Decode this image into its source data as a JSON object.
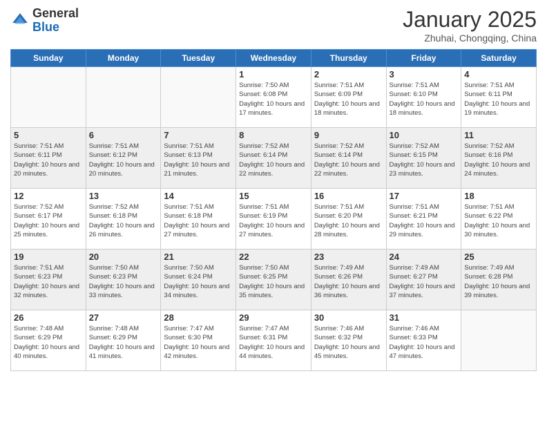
{
  "header": {
    "logo_general": "General",
    "logo_blue": "Blue",
    "month_title": "January 2025",
    "subtitle": "Zhuhai, Chongqing, China"
  },
  "days_of_week": [
    "Sunday",
    "Monday",
    "Tuesday",
    "Wednesday",
    "Thursday",
    "Friday",
    "Saturday"
  ],
  "weeks": [
    [
      {
        "day": null
      },
      {
        "day": null
      },
      {
        "day": null
      },
      {
        "day": "1",
        "sunrise": "7:50 AM",
        "sunset": "6:08 PM",
        "daylight": "10 hours and 17 minutes."
      },
      {
        "day": "2",
        "sunrise": "7:51 AM",
        "sunset": "6:09 PM",
        "daylight": "10 hours and 18 minutes."
      },
      {
        "day": "3",
        "sunrise": "7:51 AM",
        "sunset": "6:10 PM",
        "daylight": "10 hours and 18 minutes."
      },
      {
        "day": "4",
        "sunrise": "7:51 AM",
        "sunset": "6:11 PM",
        "daylight": "10 hours and 19 minutes."
      }
    ],
    [
      {
        "day": "5",
        "sunrise": "7:51 AM",
        "sunset": "6:11 PM",
        "daylight": "10 hours and 20 minutes."
      },
      {
        "day": "6",
        "sunrise": "7:51 AM",
        "sunset": "6:12 PM",
        "daylight": "10 hours and 20 minutes."
      },
      {
        "day": "7",
        "sunrise": "7:51 AM",
        "sunset": "6:13 PM",
        "daylight": "10 hours and 21 minutes."
      },
      {
        "day": "8",
        "sunrise": "7:52 AM",
        "sunset": "6:14 PM",
        "daylight": "10 hours and 22 minutes."
      },
      {
        "day": "9",
        "sunrise": "7:52 AM",
        "sunset": "6:14 PM",
        "daylight": "10 hours and 22 minutes."
      },
      {
        "day": "10",
        "sunrise": "7:52 AM",
        "sunset": "6:15 PM",
        "daylight": "10 hours and 23 minutes."
      },
      {
        "day": "11",
        "sunrise": "7:52 AM",
        "sunset": "6:16 PM",
        "daylight": "10 hours and 24 minutes."
      }
    ],
    [
      {
        "day": "12",
        "sunrise": "7:52 AM",
        "sunset": "6:17 PM",
        "daylight": "10 hours and 25 minutes."
      },
      {
        "day": "13",
        "sunrise": "7:52 AM",
        "sunset": "6:18 PM",
        "daylight": "10 hours and 26 minutes."
      },
      {
        "day": "14",
        "sunrise": "7:51 AM",
        "sunset": "6:18 PM",
        "daylight": "10 hours and 27 minutes."
      },
      {
        "day": "15",
        "sunrise": "7:51 AM",
        "sunset": "6:19 PM",
        "daylight": "10 hours and 27 minutes."
      },
      {
        "day": "16",
        "sunrise": "7:51 AM",
        "sunset": "6:20 PM",
        "daylight": "10 hours and 28 minutes."
      },
      {
        "day": "17",
        "sunrise": "7:51 AM",
        "sunset": "6:21 PM",
        "daylight": "10 hours and 29 minutes."
      },
      {
        "day": "18",
        "sunrise": "7:51 AM",
        "sunset": "6:22 PM",
        "daylight": "10 hours and 30 minutes."
      }
    ],
    [
      {
        "day": "19",
        "sunrise": "7:51 AM",
        "sunset": "6:23 PM",
        "daylight": "10 hours and 32 minutes."
      },
      {
        "day": "20",
        "sunrise": "7:50 AM",
        "sunset": "6:23 PM",
        "daylight": "10 hours and 33 minutes."
      },
      {
        "day": "21",
        "sunrise": "7:50 AM",
        "sunset": "6:24 PM",
        "daylight": "10 hours and 34 minutes."
      },
      {
        "day": "22",
        "sunrise": "7:50 AM",
        "sunset": "6:25 PM",
        "daylight": "10 hours and 35 minutes."
      },
      {
        "day": "23",
        "sunrise": "7:49 AM",
        "sunset": "6:26 PM",
        "daylight": "10 hours and 36 minutes."
      },
      {
        "day": "24",
        "sunrise": "7:49 AM",
        "sunset": "6:27 PM",
        "daylight": "10 hours and 37 minutes."
      },
      {
        "day": "25",
        "sunrise": "7:49 AM",
        "sunset": "6:28 PM",
        "daylight": "10 hours and 39 minutes."
      }
    ],
    [
      {
        "day": "26",
        "sunrise": "7:48 AM",
        "sunset": "6:29 PM",
        "daylight": "10 hours and 40 minutes."
      },
      {
        "day": "27",
        "sunrise": "7:48 AM",
        "sunset": "6:29 PM",
        "daylight": "10 hours and 41 minutes."
      },
      {
        "day": "28",
        "sunrise": "7:47 AM",
        "sunset": "6:30 PM",
        "daylight": "10 hours and 42 minutes."
      },
      {
        "day": "29",
        "sunrise": "7:47 AM",
        "sunset": "6:31 PM",
        "daylight": "10 hours and 44 minutes."
      },
      {
        "day": "30",
        "sunrise": "7:46 AM",
        "sunset": "6:32 PM",
        "daylight": "10 hours and 45 minutes."
      },
      {
        "day": "31",
        "sunrise": "7:46 AM",
        "sunset": "6:33 PM",
        "daylight": "10 hours and 47 minutes."
      },
      {
        "day": null
      }
    ]
  ]
}
